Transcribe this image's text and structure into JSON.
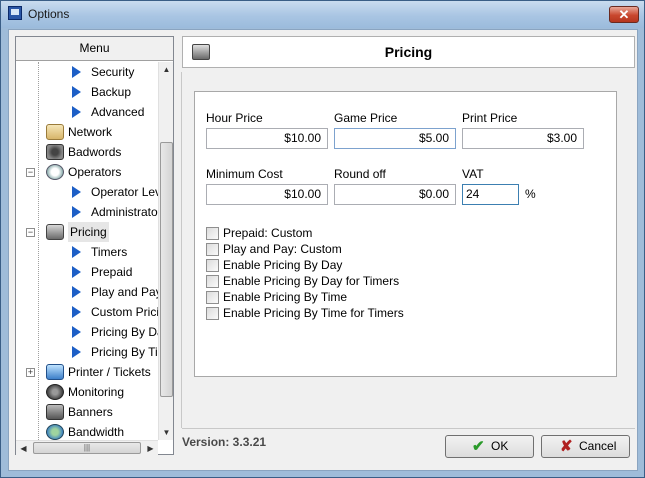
{
  "window": {
    "title": "Options",
    "close_glyph": "✕"
  },
  "menu": {
    "header": "Menu",
    "items": [
      {
        "label": "Security",
        "icon": "blue-arrow-icon"
      },
      {
        "label": "Backup",
        "icon": "blue-arrow-icon"
      },
      {
        "label": "Advanced",
        "icon": "blue-arrow-icon"
      },
      {
        "label": "Network",
        "icon": "network-icon"
      },
      {
        "label": "Badwords",
        "icon": "badwords-icon"
      },
      {
        "label": "Operators",
        "icon": "operators-icon",
        "expander": "−"
      },
      {
        "label": "Operator Leve",
        "icon": "blue-arrow-icon"
      },
      {
        "label": "Administrator",
        "icon": "blue-arrow-icon"
      },
      {
        "label": "Pricing",
        "icon": "pricing-icon",
        "expander": "−"
      },
      {
        "label": "Timers",
        "icon": "blue-arrow-icon"
      },
      {
        "label": "Prepaid",
        "icon": "blue-arrow-icon"
      },
      {
        "label": "Play and Pay",
        "icon": "blue-arrow-icon"
      },
      {
        "label": "Custom Pricin",
        "icon": "blue-arrow-icon"
      },
      {
        "label": "Pricing By Da",
        "icon": "blue-arrow-icon"
      },
      {
        "label": "Pricing By Tin",
        "icon": "blue-arrow-icon"
      },
      {
        "label": "Printer / Tickets",
        "icon": "printer-icon",
        "expander": "+"
      },
      {
        "label": "Monitoring",
        "icon": "monitoring-icon"
      },
      {
        "label": "Banners",
        "icon": "banners-icon"
      },
      {
        "label": "Bandwidth",
        "icon": "bandwidth-icon"
      }
    ],
    "scroll_up": "▲",
    "scroll_down": "▼",
    "scroll_left": "◀",
    "scroll_right": "▶",
    "scroll_grip": "|||"
  },
  "page": {
    "title": "Pricing",
    "icon": "pricing-icon"
  },
  "fields": {
    "hour_price": {
      "label": "Hour Price",
      "value": "$10.00"
    },
    "game_price": {
      "label": "Game Price",
      "value": "$5.00"
    },
    "print_price": {
      "label": "Print Price",
      "value": "$3.00"
    },
    "minimum_cost": {
      "label": "Minimum Cost",
      "value": "$10.00"
    },
    "round_off": {
      "label": "Round off",
      "value": "$0.00"
    },
    "vat": {
      "label": "VAT",
      "value": "24",
      "unit": "%"
    }
  },
  "checkboxes": [
    {
      "label": "Prepaid: Custom",
      "checked": false
    },
    {
      "label": "Play and Pay: Custom",
      "checked": false
    },
    {
      "label": "Enable Pricing By Day",
      "checked": false
    },
    {
      "label": "Enable Pricing By Day for Timers",
      "checked": false
    },
    {
      "label": "Enable Pricing By Time",
      "checked": false
    },
    {
      "label": "Enable Pricing By Time for Timers",
      "checked": false
    }
  ],
  "footer": {
    "version": "Version: 3.3.21",
    "ok_label": "OK",
    "ok_icon": "✔",
    "cancel_label": "Cancel",
    "cancel_icon": "✘"
  },
  "colors": {
    "accent": "#1d5fc6",
    "ok_icon": "#2a9a2a",
    "cancel_icon": "#b02020"
  }
}
